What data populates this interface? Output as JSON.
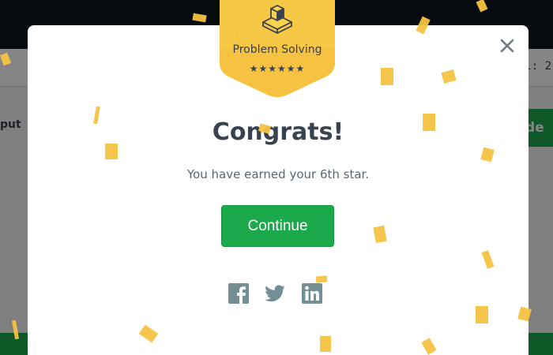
{
  "background": {
    "left_label": "put",
    "right_label": "l: 2",
    "right_button_label": "de"
  },
  "modal": {
    "badge": {
      "title": "Problem Solving",
      "stars": "★★★★★★",
      "icon": "cube-on-platform-icon"
    },
    "heading": "Congrats!",
    "message": "You have earned your 6th star.",
    "continue_label": "Continue",
    "close_icon": "close-icon",
    "share": [
      {
        "icon": "facebook-icon"
      },
      {
        "icon": "twitter-icon"
      },
      {
        "icon": "linkedin-icon"
      }
    ]
  },
  "colors": {
    "topbar": "#0e141e",
    "accent_green": "#1ba94c",
    "badge_yellow": "#f6c242",
    "text_dark": "#39424e",
    "icon_grey": "#738f93",
    "confetti": "#f6c242"
  }
}
